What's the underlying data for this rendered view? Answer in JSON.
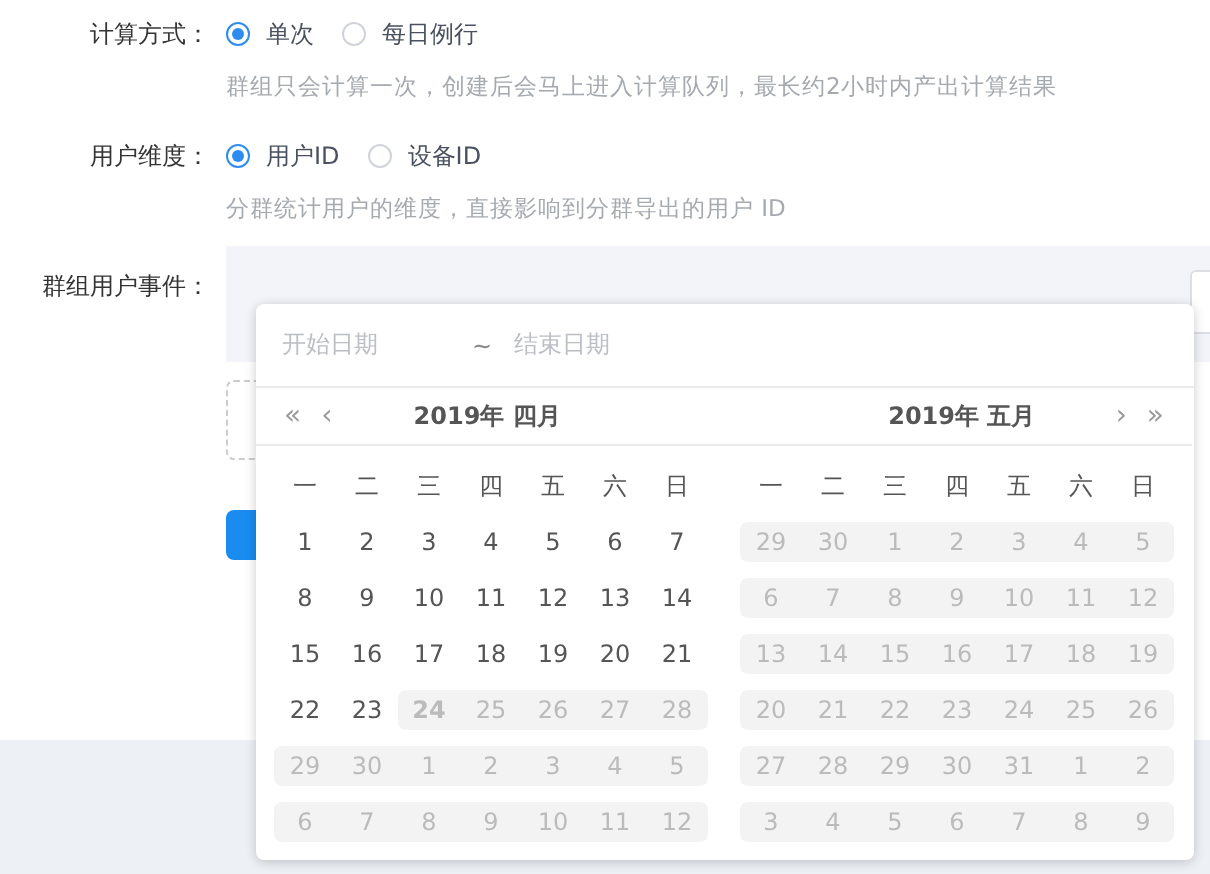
{
  "form": {
    "fields": [
      {
        "label": "计算方式：",
        "options": [
          {
            "label": "单次",
            "selected": true
          },
          {
            "label": "每日例行",
            "selected": false
          }
        ],
        "hint": "群组只会计算一次，创建后会马上进入计算队列，最长约2小时内产出计算结果"
      },
      {
        "label": "用户维度：",
        "options": [
          {
            "label": "用户ID",
            "selected": true
          },
          {
            "label": "设备ID",
            "selected": false
          }
        ],
        "hint": "分群统计用户的维度，直接影响到分群导出的用户 ID"
      }
    ],
    "event_label": "群组用户事件："
  },
  "date_picker": {
    "start_placeholder": "开始日期",
    "separator": "~",
    "end_placeholder": "结束日期",
    "prev_year": "«",
    "prev_month": "‹",
    "next_month": "›",
    "next_year": "»",
    "months": [
      {
        "title": "2019年 四月",
        "weekdays": [
          "一",
          "二",
          "三",
          "四",
          "五",
          "六",
          "日"
        ],
        "weeks": [
          [
            {
              "d": "1",
              "disabled": false,
              "today": false
            },
            {
              "d": "2",
              "disabled": false,
              "today": false
            },
            {
              "d": "3",
              "disabled": false,
              "today": false
            },
            {
              "d": "4",
              "disabled": false,
              "today": false
            },
            {
              "d": "5",
              "disabled": false,
              "today": false
            },
            {
              "d": "6",
              "disabled": false,
              "today": false
            },
            {
              "d": "7",
              "disabled": false,
              "today": false
            }
          ],
          [
            {
              "d": "8",
              "disabled": false,
              "today": false
            },
            {
              "d": "9",
              "disabled": false,
              "today": false
            },
            {
              "d": "10",
              "disabled": false,
              "today": false
            },
            {
              "d": "11",
              "disabled": false,
              "today": false
            },
            {
              "d": "12",
              "disabled": false,
              "today": false
            },
            {
              "d": "13",
              "disabled": false,
              "today": false
            },
            {
              "d": "14",
              "disabled": false,
              "today": false
            }
          ],
          [
            {
              "d": "15",
              "disabled": false,
              "today": false
            },
            {
              "d": "16",
              "disabled": false,
              "today": false
            },
            {
              "d": "17",
              "disabled": false,
              "today": false
            },
            {
              "d": "18",
              "disabled": false,
              "today": false
            },
            {
              "d": "19",
              "disabled": false,
              "today": false
            },
            {
              "d": "20",
              "disabled": false,
              "today": false
            },
            {
              "d": "21",
              "disabled": false,
              "today": false
            }
          ],
          [
            {
              "d": "22",
              "disabled": false,
              "today": false
            },
            {
              "d": "23",
              "disabled": false,
              "today": false
            },
            {
              "d": "24",
              "disabled": true,
              "today": true
            },
            {
              "d": "25",
              "disabled": true,
              "today": false
            },
            {
              "d": "26",
              "disabled": true,
              "today": false
            },
            {
              "d": "27",
              "disabled": true,
              "today": false
            },
            {
              "d": "28",
              "disabled": true,
              "today": false
            }
          ],
          [
            {
              "d": "29",
              "disabled": true,
              "today": false
            },
            {
              "d": "30",
              "disabled": true,
              "today": false
            },
            {
              "d": "1",
              "disabled": true,
              "today": false
            },
            {
              "d": "2",
              "disabled": true,
              "today": false
            },
            {
              "d": "3",
              "disabled": true,
              "today": false
            },
            {
              "d": "4",
              "disabled": true,
              "today": false
            },
            {
              "d": "5",
              "disabled": true,
              "today": false
            }
          ],
          [
            {
              "d": "6",
              "disabled": true,
              "today": false
            },
            {
              "d": "7",
              "disabled": true,
              "today": false
            },
            {
              "d": "8",
              "disabled": true,
              "today": false
            },
            {
              "d": "9",
              "disabled": true,
              "today": false
            },
            {
              "d": "10",
              "disabled": true,
              "today": false
            },
            {
              "d": "11",
              "disabled": true,
              "today": false
            },
            {
              "d": "12",
              "disabled": true,
              "today": false
            }
          ]
        ]
      },
      {
        "title": "2019年 五月",
        "weekdays": [
          "一",
          "二",
          "三",
          "四",
          "五",
          "六",
          "日"
        ],
        "weeks": [
          [
            {
              "d": "29",
              "disabled": true,
              "today": false
            },
            {
              "d": "30",
              "disabled": true,
              "today": false
            },
            {
              "d": "1",
              "disabled": true,
              "today": false
            },
            {
              "d": "2",
              "disabled": true,
              "today": false
            },
            {
              "d": "3",
              "disabled": true,
              "today": false
            },
            {
              "d": "4",
              "disabled": true,
              "today": false
            },
            {
              "d": "5",
              "disabled": true,
              "today": false
            }
          ],
          [
            {
              "d": "6",
              "disabled": true,
              "today": false
            },
            {
              "d": "7",
              "disabled": true,
              "today": false
            },
            {
              "d": "8",
              "disabled": true,
              "today": false
            },
            {
              "d": "9",
              "disabled": true,
              "today": false
            },
            {
              "d": "10",
              "disabled": true,
              "today": false
            },
            {
              "d": "11",
              "disabled": true,
              "today": false
            },
            {
              "d": "12",
              "disabled": true,
              "today": false
            }
          ],
          [
            {
              "d": "13",
              "disabled": true,
              "today": false
            },
            {
              "d": "14",
              "disabled": true,
              "today": false
            },
            {
              "d": "15",
              "disabled": true,
              "today": false
            },
            {
              "d": "16",
              "disabled": true,
              "today": false
            },
            {
              "d": "17",
              "disabled": true,
              "today": false
            },
            {
              "d": "18",
              "disabled": true,
              "today": false
            },
            {
              "d": "19",
              "disabled": true,
              "today": false
            }
          ],
          [
            {
              "d": "20",
              "disabled": true,
              "today": false
            },
            {
              "d": "21",
              "disabled": true,
              "today": false
            },
            {
              "d": "22",
              "disabled": true,
              "today": false
            },
            {
              "d": "23",
              "disabled": true,
              "today": false
            },
            {
              "d": "24",
              "disabled": true,
              "today": false
            },
            {
              "d": "25",
              "disabled": true,
              "today": false
            },
            {
              "d": "26",
              "disabled": true,
              "today": false
            }
          ],
          [
            {
              "d": "27",
              "disabled": true,
              "today": false
            },
            {
              "d": "28",
              "disabled": true,
              "today": false
            },
            {
              "d": "29",
              "disabled": true,
              "today": false
            },
            {
              "d": "30",
              "disabled": true,
              "today": false
            },
            {
              "d": "31",
              "disabled": true,
              "today": false
            },
            {
              "d": "1",
              "disabled": true,
              "today": false
            },
            {
              "d": "2",
              "disabled": true,
              "today": false
            }
          ],
          [
            {
              "d": "3",
              "disabled": true,
              "today": false
            },
            {
              "d": "4",
              "disabled": true,
              "today": false
            },
            {
              "d": "5",
              "disabled": true,
              "today": false
            },
            {
              "d": "6",
              "disabled": true,
              "today": false
            },
            {
              "d": "7",
              "disabled": true,
              "today": false
            },
            {
              "d": "8",
              "disabled": true,
              "today": false
            },
            {
              "d": "9",
              "disabled": true,
              "today": false
            }
          ]
        ]
      }
    ]
  }
}
